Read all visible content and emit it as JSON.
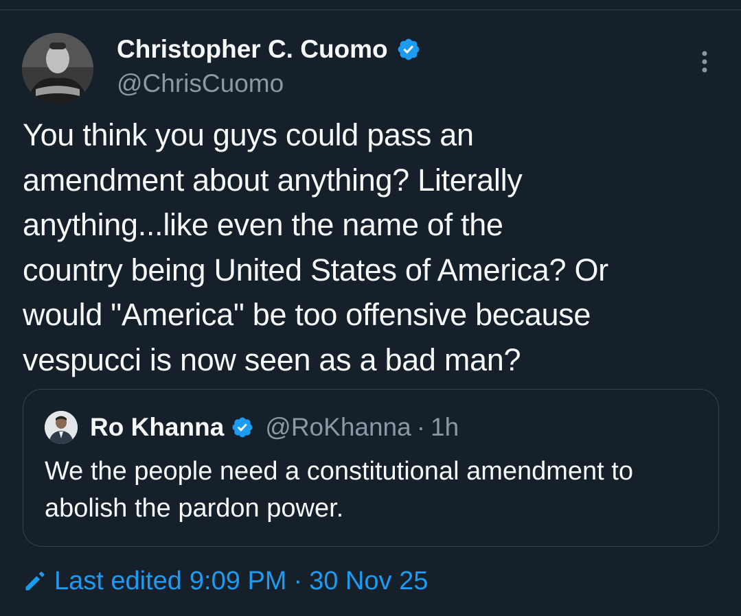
{
  "author": {
    "display_name": "Christopher C. Cuomo",
    "handle": "@ChrisCuomo",
    "verified": true,
    "avatar_icon": "profile-photo"
  },
  "tweet": {
    "text": "You think you guys could pass an\namendment about anything? Literally\nanything...like even the name of the\ncountry being United States of America? Or\nwould \"America\" be too offensive because\nvespucci is now seen as a bad man?"
  },
  "quoted_tweet": {
    "display_name": "Ro Khanna",
    "handle": "@RoKhanna",
    "separator": "·",
    "time": "1h",
    "verified": true,
    "text": "We the people need a constitutional amendment to abolish the pardon power."
  },
  "edit_info": {
    "label": "Last edited",
    "time": "9:09 PM",
    "separator": "·",
    "date": "30 Nov 25",
    "icon": "pencil-icon"
  },
  "icons": {
    "verified": "verified-badge-icon",
    "more": "more-options-icon"
  },
  "colors": {
    "background": "#15202b",
    "text": "#f7f9f9",
    "secondary_text": "#8b98a5",
    "accent": "#1d9bf0",
    "border": "#38444d"
  }
}
